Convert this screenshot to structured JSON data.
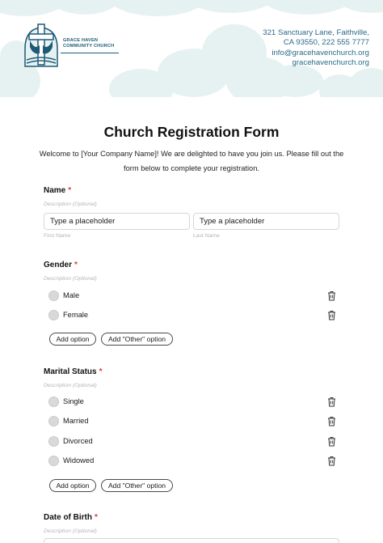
{
  "brand": {
    "name_line1": "GRACE HAVEN",
    "name_line2": "COMMUNITY CHURCH",
    "accent_color": "#1e5a78"
  },
  "contact": {
    "address": "321 Sanctuary Lane, Faithville,",
    "city_phone": "CA 93550, 222 555 7777",
    "email": "info@gracehavenchurch.org",
    "website": "gracehavenchurch.org"
  },
  "form": {
    "title": "Church Registration Form",
    "intro": "Welcome to [Your Company Name]! We are delighted to have you join us. Please fill out the form below to complete your registration.",
    "name": {
      "label": "Name",
      "required_mark": "*",
      "description": "Description (Optional)",
      "first_value": "Type a placeholder",
      "first_sublabel": "First Name",
      "last_value": "Type a placeholder",
      "last_sublabel": "Last Name"
    },
    "gender": {
      "label": "Gender",
      "required_mark": "*",
      "description": "Description (Optional)",
      "options": [
        "Male",
        "Female"
      ],
      "add_option": "Add option",
      "add_other": "Add \"Other\" option"
    },
    "marital": {
      "label": "Marital Status",
      "required_mark": "*",
      "description": "Description (Optional)",
      "options": [
        "Single",
        "Married",
        "Divorced",
        "Widowed"
      ],
      "add_option": "Add option",
      "add_other": "Add \"Other\" option"
    },
    "dob": {
      "label": "Date of Birth",
      "required_mark": "*",
      "description": "Description (Optional)"
    }
  }
}
